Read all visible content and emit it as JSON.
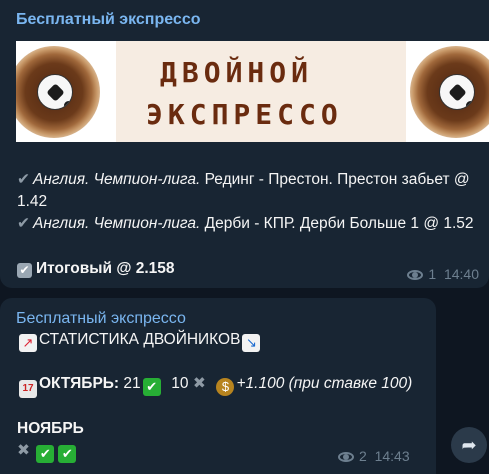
{
  "messages": [
    {
      "sender": "Бесплатный экспрессо",
      "banner_text": [
        "ДВОЙНОЙ",
        "ЭКСПРЕССО"
      ],
      "lines": [
        {
          "italic": "Англия. Чемпион-лига.",
          "text": " Рединг - Престон. Престон забьет @ 1.42"
        },
        {
          "italic": "Англия. Чемпион-лига.",
          "text": " Дерби - КПР. Дерби Больше 1 @ 1.52"
        }
      ],
      "total": "Итоговый @ 2.158",
      "views": "1",
      "time": "14:40"
    },
    {
      "sender": "Бесплатный экспрессо",
      "stats_title": "СТАТИСТИКА ДВОЙНИКОВ",
      "october_label": "ОКТЯБРЬ:",
      "october_wins": "21",
      "october_losses": "10",
      "october_profit": "+1.100 (при ставке 100)",
      "november_label": "НОЯБРЬ",
      "views": "2",
      "time": "14:43"
    }
  ],
  "icons": {
    "share": "share-arrow-icon",
    "views": "eye-icon"
  },
  "colors": {
    "background": "#0e1621",
    "bubble": "#182533",
    "sender": "#7ab6f0",
    "meta": "#6d7f8f",
    "green_check": "#27ae35"
  }
}
